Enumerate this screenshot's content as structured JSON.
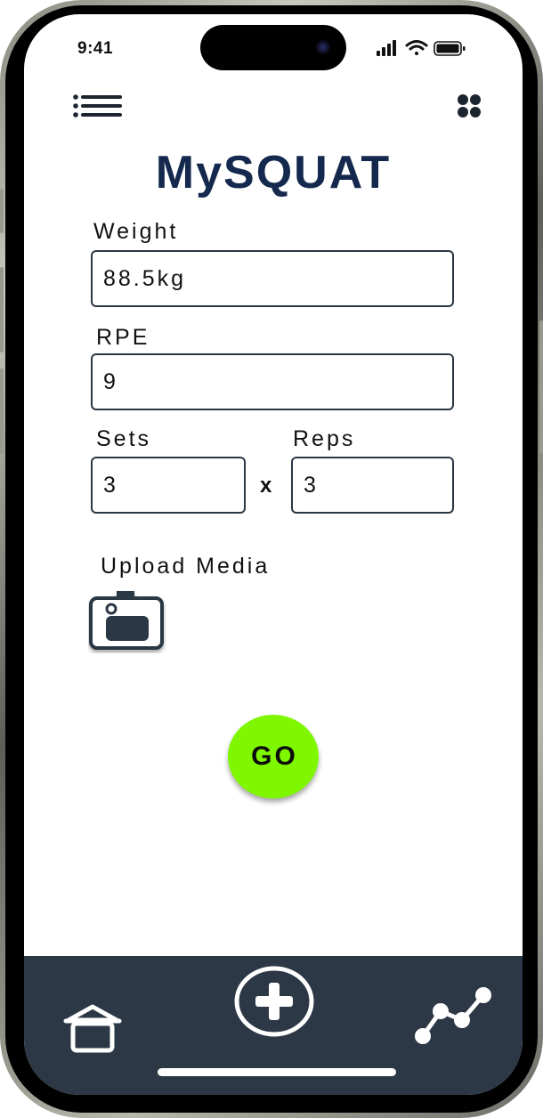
{
  "status_bar": {
    "time": "9:41"
  },
  "header": {
    "title": "MySQUAT"
  },
  "form": {
    "weight": {
      "label": "Weight",
      "value": "88.5kg"
    },
    "rpe": {
      "label": "RPE",
      "value": "9"
    },
    "sets": {
      "label": "Sets",
      "value": "3"
    },
    "times": "x",
    "reps": {
      "label": "Reps",
      "value": "3"
    },
    "upload_label": "Upload Media"
  },
  "go_button": {
    "label": "GO",
    "color": "#7ef700"
  },
  "bottom_nav": {
    "items": [
      {
        "icon": "home-icon"
      },
      {
        "icon": "add-circle-icon"
      },
      {
        "icon": "stats-graph-icon"
      }
    ],
    "background": "#2d3846"
  },
  "colors": {
    "title": "#14294d",
    "field_border": "#2b3745"
  }
}
